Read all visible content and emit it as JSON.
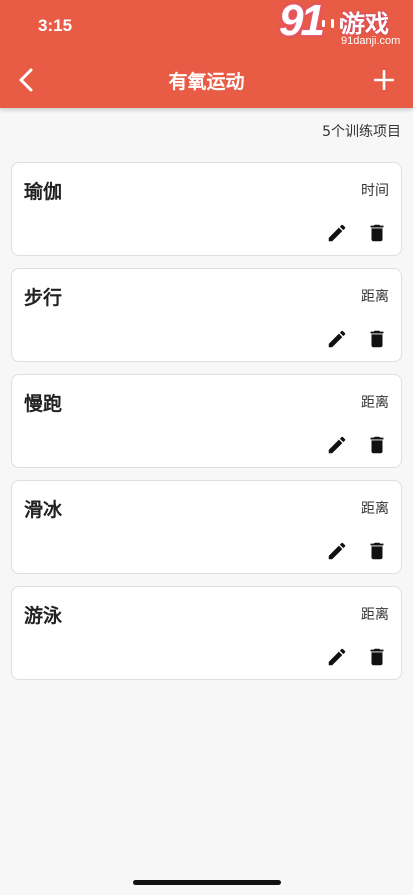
{
  "status_bar": {
    "time": "3:15"
  },
  "watermark": {
    "number": "91",
    "brand": "游戏",
    "domain": "91danji.com"
  },
  "header": {
    "title": "有氧运动",
    "back_icon": "chevron-left-icon",
    "add_icon": "plus-icon"
  },
  "summary": {
    "count_text": "5个训练项目"
  },
  "exercises": [
    {
      "name": "瑜伽",
      "type": "时间"
    },
    {
      "name": "步行",
      "type": "距离"
    },
    {
      "name": "慢跑",
      "type": "距离"
    },
    {
      "name": "滑冰",
      "type": "距离"
    },
    {
      "name": "游泳",
      "type": "距离"
    }
  ],
  "colors": {
    "header": "#e85b45",
    "background": "#f7f7f7",
    "card": "#ffffff"
  }
}
